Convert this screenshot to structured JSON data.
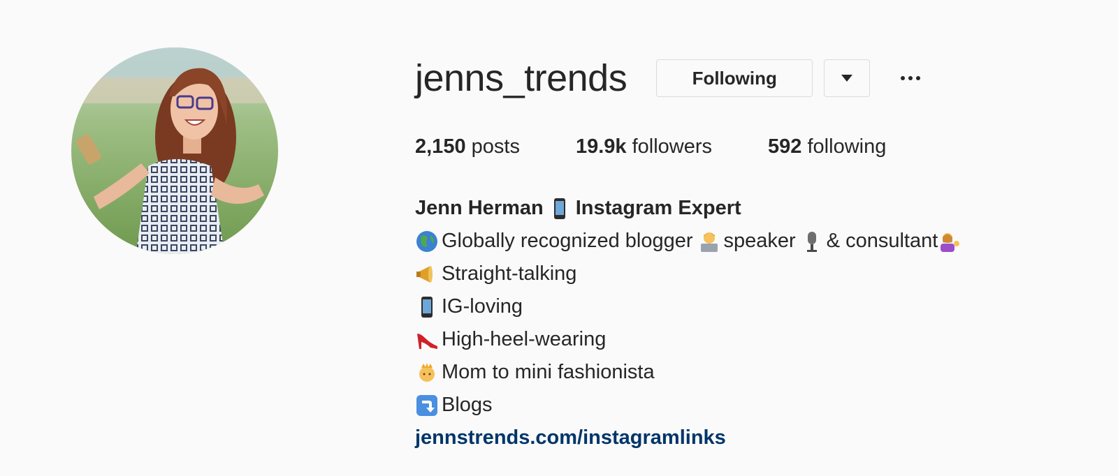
{
  "profile": {
    "username": "jenns_trends",
    "following_button": "Following",
    "stats": [
      {
        "value": "2,150",
        "label": "posts"
      },
      {
        "value": "19.9k",
        "label": "followers"
      },
      {
        "value": "592",
        "label": "following"
      }
    ],
    "bio": {
      "name": "Jenn Herman",
      "name_suffix": "Instagram Expert",
      "line1_a": "Globally recognized blogger",
      "line1_b": "speaker",
      "line1_c": "& consultant",
      "line2": "Straight-talking",
      "line3": "IG-loving",
      "line4": "High-heel-wearing",
      "line5": "Mom to mini fashionista",
      "line6": "Blogs",
      "link": "jennstrends.com/instagramlinks"
    }
  },
  "colors": {
    "background": "#fafafa",
    "text": "#262626",
    "link": "#003569",
    "border": "#dbdbdb"
  },
  "icons": [
    "profile-photo",
    "chevron-down-icon",
    "more-options-icon",
    "mobile-phone-emoji",
    "globe-emoji",
    "technologist-emoji",
    "microphone-emoji",
    "tipping-hand-emoji",
    "megaphone-emoji",
    "high-heel-emoji",
    "princess-emoji",
    "arrow-down-emoji"
  ]
}
